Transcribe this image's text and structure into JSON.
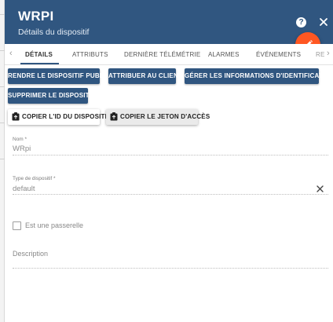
{
  "header": {
    "title": "WRPI",
    "subtitle": "Détails du dispositif",
    "help_glyph": "?",
    "colors": {
      "primary": "#305680",
      "accent": "#ff5722"
    }
  },
  "tabs": [
    {
      "label": "DÉTAILS",
      "active": true
    },
    {
      "label": "ATTRIBUTS",
      "active": false
    },
    {
      "label": "DERNIÈRE TÉLÉMÉTRIE",
      "active": false
    },
    {
      "label": "ALARMES",
      "active": false
    },
    {
      "label": "ÉVÉNEMENTS",
      "active": false
    },
    {
      "label": "RE",
      "active": false
    }
  ],
  "tab_scroll": {
    "left": "‹",
    "right": "›"
  },
  "actions": {
    "make_public": "RENDRE LE DISPOSITIF PUBLIC",
    "assign_client": "ATTRIBUER AU CLIENT",
    "manage_credentials": "GÉRER LES INFORMATIONS D'IDENTIFICATION",
    "delete_device": "SUPPRIMER LE DISPOSITIF",
    "copy_id": "COPIER L'ID DU DISPOSITIF",
    "copy_token": "COPIER LE JETON D'ACCÈS"
  },
  "form": {
    "name": {
      "label": "Nom *",
      "value": "WRpi"
    },
    "device_type": {
      "label": "Type de dispositif *",
      "value": "default"
    },
    "gateway": {
      "label": "Est une passerelle",
      "checked": false
    },
    "description": {
      "label": "Description",
      "value": ""
    }
  },
  "icons": [
    "help-icon",
    "close-icon",
    "edit-icon",
    "clipboard-icon",
    "clear-icon",
    "chevron-left-icon",
    "chevron-right-icon"
  ]
}
